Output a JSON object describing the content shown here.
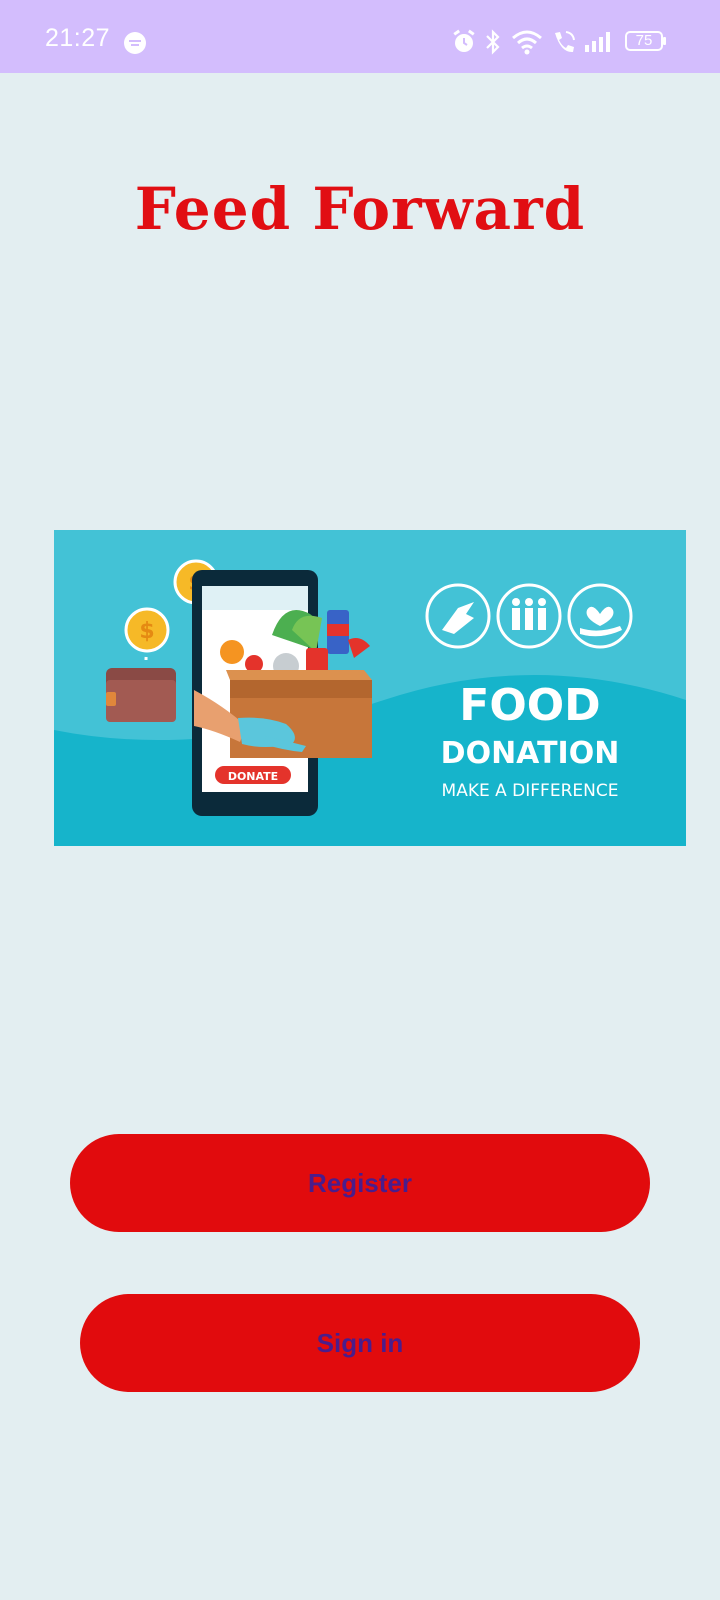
{
  "status_bar": {
    "time": "21:27",
    "battery": "75",
    "icons": [
      "notification-badge-icon",
      "alarm-icon",
      "bluetooth-icon",
      "wifi-icon",
      "wifi-call-icon",
      "signal-icon",
      "battery-icon"
    ]
  },
  "header": {
    "title": "Feed Forward"
  },
  "banner": {
    "headline": "FOOD",
    "subheadline": "DONATION",
    "tagline": "MAKE A DIFFERENCE",
    "phone_button_label": "DONATE",
    "icons": [
      "helping-hands-icon",
      "people-group-icon",
      "heart-in-hand-icon",
      "wallet-icon",
      "coin-icon",
      "food-box-icon"
    ]
  },
  "actions": {
    "register_label": "Register",
    "signin_label": "Sign in"
  },
  "colors": {
    "status_bar": "#d3bdfd",
    "background": "#e3eef1",
    "title": "#e10e13",
    "button": "#e10b0d",
    "button_text": "#4a1d8c",
    "banner": "#43c2d6"
  }
}
